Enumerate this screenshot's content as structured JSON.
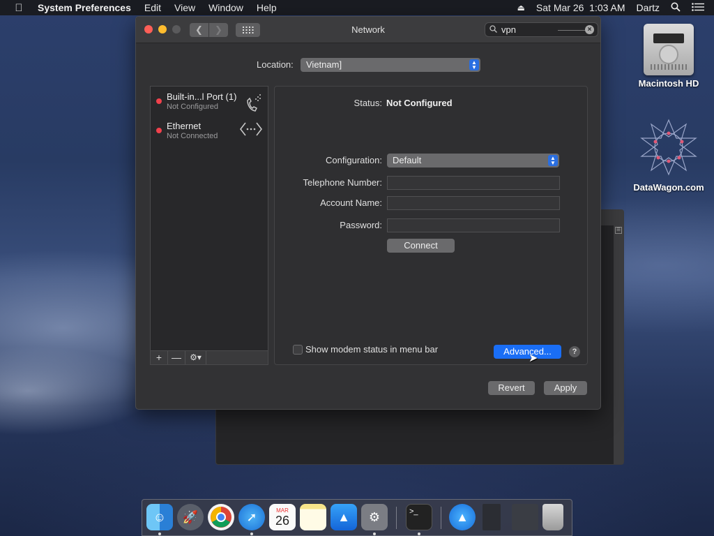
{
  "menubar": {
    "app_name": "System Preferences",
    "items": [
      "Edit",
      "View",
      "Window",
      "Help"
    ],
    "clock": "Sat Mar 26  1:03 AM",
    "user": "Dartz"
  },
  "window": {
    "title": "Network",
    "search_value": "vpn",
    "location_label": "Location:",
    "location_value": "Vietnam]"
  },
  "services": [
    {
      "name": "Built-in...l Port (1)",
      "status": "Not Configured",
      "status_color": "#f0414c"
    },
    {
      "name": "Ethernet",
      "status": "Not Connected",
      "status_color": "#f0414c"
    }
  ],
  "detail": {
    "status_label": "Status:",
    "status_value": "Not Configured",
    "configuration_label": "Configuration:",
    "configuration_value": "Default",
    "telephone_label": "Telephone Number:",
    "telephone_value": "",
    "account_label": "Account Name:",
    "account_value": "",
    "password_label": "Password:",
    "password_value": "",
    "connect_label": "Connect",
    "modem_checkbox_label": "Show modem status in menu bar",
    "modem_checkbox_checked": false,
    "advanced_label": "Advanced...",
    "help_label": "?"
  },
  "footer": {
    "revert_label": "Revert",
    "apply_label": "Apply"
  },
  "desktop": {
    "icons": [
      {
        "label": "Macintosh HD",
        "icon": "hard-drive-icon"
      },
      {
        "label": "DataWagon.com",
        "icon": "star-pattern-icon"
      }
    ]
  },
  "dock": {
    "calendar_month": "MAR",
    "calendar_day": "26",
    "items": [
      "finder",
      "launchpad",
      "chrome",
      "safari",
      "calendar",
      "notes",
      "app-store",
      "system-preferences",
      "terminal",
      "app-store-2",
      "html-file",
      "script-file",
      "trash"
    ]
  },
  "colors": {
    "accent": "#1a6ef5",
    "status_red": "#f0414c",
    "window_bg": "#323234"
  }
}
